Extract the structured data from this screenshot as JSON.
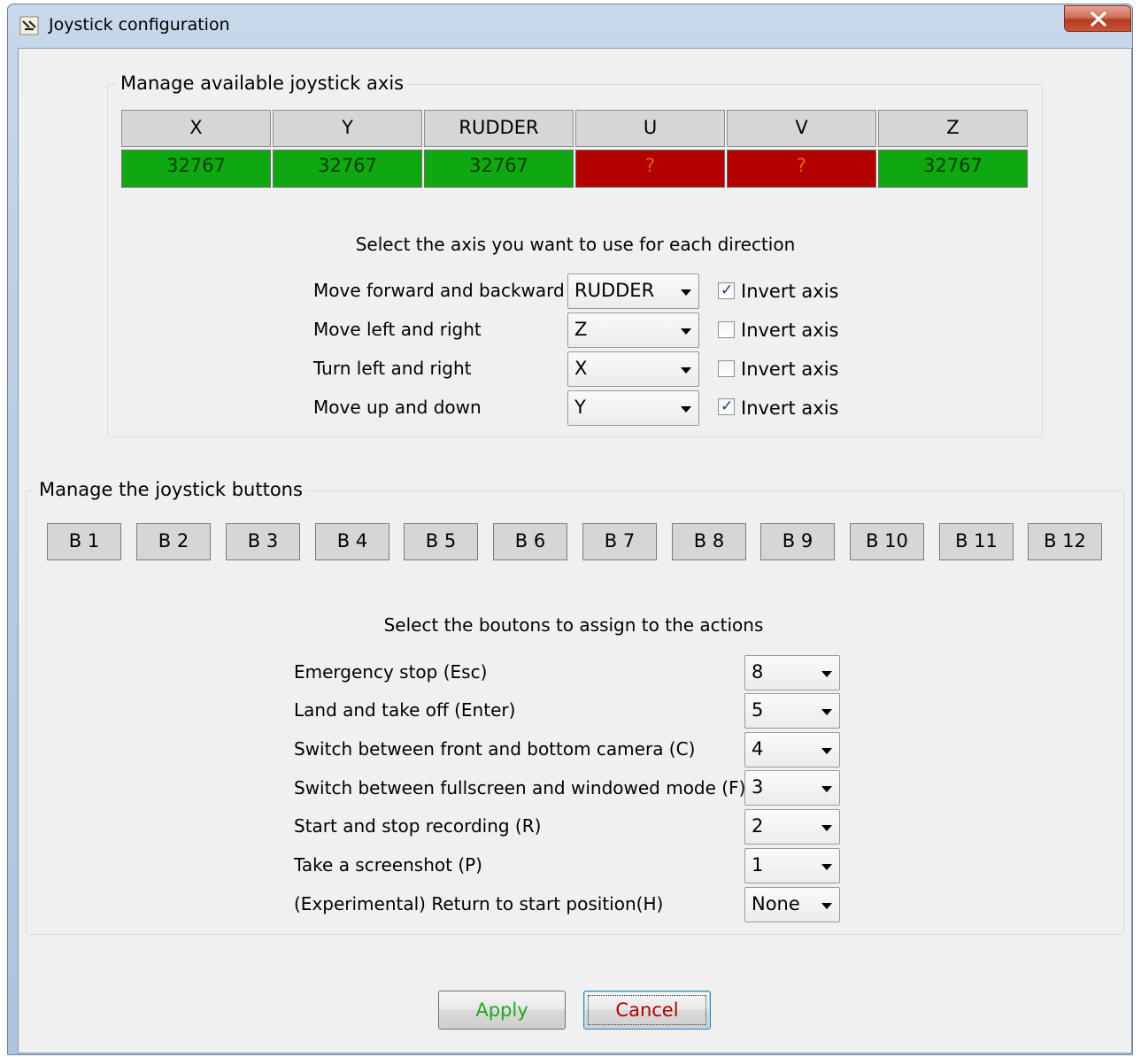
{
  "window": {
    "title": "Joystick configuration",
    "close_label": "x"
  },
  "axis_group": {
    "title": "Manage available joystick axis",
    "axes": [
      {
        "name": "X",
        "value": "32767",
        "status": "ok"
      },
      {
        "name": "Y",
        "value": "32767",
        "status": "ok"
      },
      {
        "name": "RUDDER",
        "value": "32767",
        "status": "ok"
      },
      {
        "name": "U",
        "value": "?",
        "status": "bad"
      },
      {
        "name": "V",
        "value": "?",
        "status": "bad"
      },
      {
        "name": "Z",
        "value": "32767",
        "status": "ok"
      }
    ],
    "instruction": "Select the axis you want to use for each direction",
    "directions": [
      {
        "label": "Move forward and backward",
        "axis": "RUDDER",
        "invert_label": "Invert axis",
        "invert": true
      },
      {
        "label": "Move left and right",
        "axis": "Z",
        "invert_label": "Invert axis",
        "invert": false
      },
      {
        "label": "Turn left and right",
        "axis": "X",
        "invert_label": "Invert axis",
        "invert": false
      },
      {
        "label": "Move up and down",
        "axis": "Y",
        "invert_label": "Invert axis",
        "invert": true
      }
    ]
  },
  "buttons_group": {
    "title": "Manage the joystick buttons",
    "buttons": [
      "B 1",
      "B 2",
      "B 3",
      "B 4",
      "B 5",
      "B 6",
      "B 7",
      "B 8",
      "B 9",
      "B 10",
      "B 11",
      "B 12"
    ],
    "instruction": "Select the boutons to assign to the actions",
    "actions": [
      {
        "label": "Emergency stop (Esc)",
        "value": "8"
      },
      {
        "label": "Land and take off (Enter)",
        "value": "5"
      },
      {
        "label": "Switch between front and bottom camera (C)",
        "value": "4"
      },
      {
        "label": "Switch between fullscreen and windowed mode (F)",
        "value": "3"
      },
      {
        "label": "Start and stop recording (R)",
        "value": "2"
      },
      {
        "label": "Take a screenshot (P)",
        "value": "1"
      },
      {
        "label": "(Experimental) Return to start position(H)",
        "value": "None"
      }
    ]
  },
  "footer": {
    "apply_label": "Apply",
    "cancel_label": "Cancel"
  },
  "colors": {
    "ok": "#10a810",
    "bad": "#b30000",
    "apply_text": "#1fa81f",
    "cancel_text": "#b00000"
  }
}
